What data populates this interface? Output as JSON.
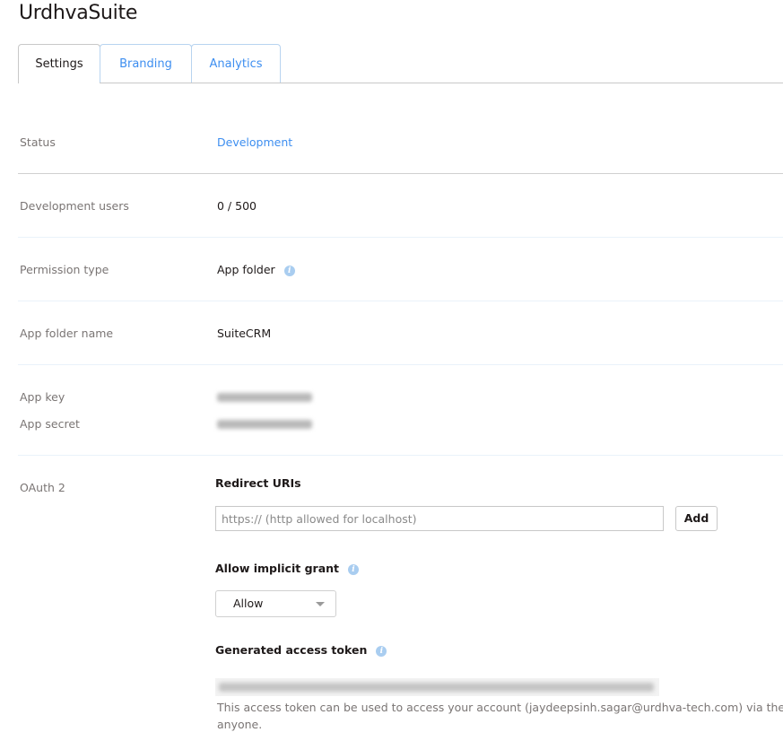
{
  "app": {
    "title": "UrdhvaSuite"
  },
  "tabs": [
    {
      "label": "Settings",
      "active": true
    },
    {
      "label": "Branding"
    },
    {
      "label": "Analytics"
    }
  ],
  "settings": {
    "status": {
      "label": "Status",
      "value": "Development"
    },
    "dev_users": {
      "label": "Development users",
      "value": "0 / 500"
    },
    "permission": {
      "label": "Permission type",
      "value": "App folder",
      "icon": "info-icon"
    },
    "folder": {
      "label": "App folder name",
      "value": "SuiteCRM"
    },
    "app_key": {
      "label": "App key"
    },
    "app_secret": {
      "label": "App secret"
    },
    "oauth": {
      "label": "OAuth 2",
      "redirect_heading": "Redirect URIs",
      "redirect_placeholder": "https:// (http allowed for localhost)",
      "add_label": "Add",
      "implicit_heading": "Allow implicit grant",
      "implicit_value": "Allow",
      "token_heading": "Generated access token",
      "token_desc1": "This access token can be used to access your account (jaydeepsinh.sagar@urdhva-tech.com) via the API.",
      "token_desc2": "anyone."
    }
  },
  "colors": {
    "accent": "#3d8ef0",
    "info_icon": "#a9cdf0"
  }
}
